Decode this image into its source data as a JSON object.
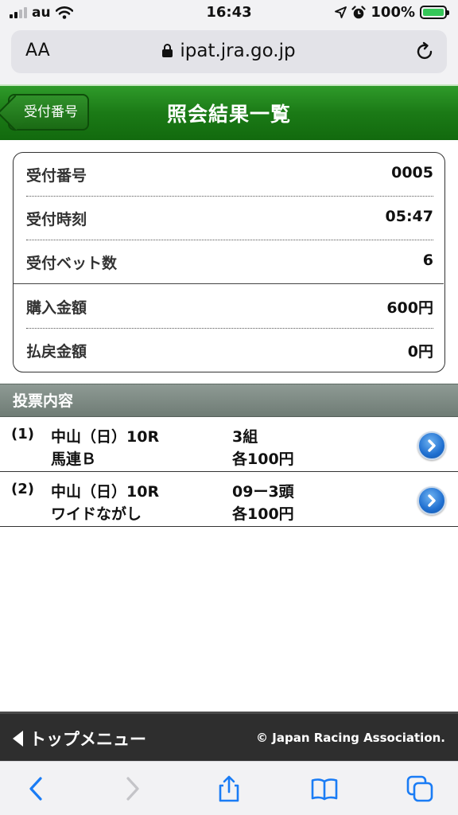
{
  "status_bar": {
    "carrier": "au",
    "time": "16:43",
    "battery": "100%",
    "signal_bars": 2,
    "battery_level": 1.0
  },
  "browser": {
    "aa_label": "AA",
    "url": "ipat.jra.go.jp"
  },
  "header": {
    "back_label": "受付番号",
    "title": "照会結果一覧"
  },
  "summary": {
    "rows": [
      {
        "label": "受付番号",
        "value": "0005"
      },
      {
        "label": "受付時刻",
        "value": "05:47"
      },
      {
        "label": "受付ベット数",
        "value": "6"
      },
      {
        "label": "購入金額",
        "value": "600円"
      },
      {
        "label": "払戻金額",
        "value": "0円"
      }
    ]
  },
  "bets": {
    "section_title": "投票内容",
    "items": [
      {
        "index": "(1)",
        "race": "中山（日）10R",
        "type": "馬連Ｂ",
        "combo": "3組",
        "amount": "各100円"
      },
      {
        "index": "(2)",
        "race": "中山（日）10R",
        "type": "ワイドながし",
        "combo": "09ー3頭",
        "amount": "各100円"
      }
    ]
  },
  "footer": {
    "menu_label": "トップメニュー",
    "copyright": "© Japan Racing Association."
  },
  "colors": {
    "header_green": "#1b7a16",
    "section_gray": "#7d8a83",
    "chevron_blue": "#1f6fd0",
    "ios_blue": "#1a7cf5"
  }
}
